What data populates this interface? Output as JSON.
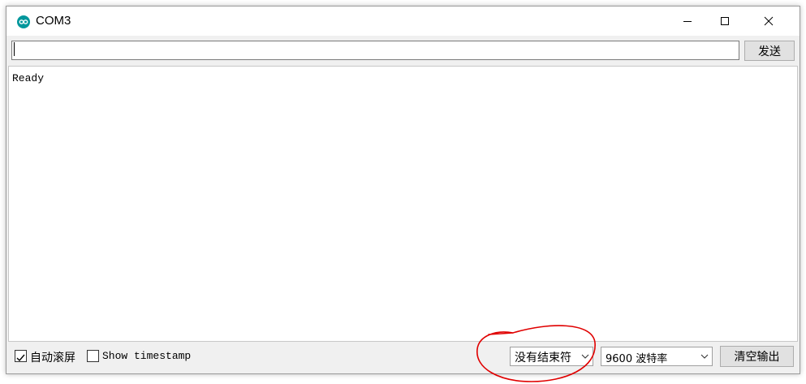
{
  "window": {
    "title": "COM3",
    "icon": "arduino-icon"
  },
  "send": {
    "input_value": "",
    "button_label": "发送"
  },
  "output": {
    "lines": [
      "Ready"
    ]
  },
  "statusbar": {
    "autoscroll": {
      "label": "自动滚屏",
      "checked": true
    },
    "timestamp": {
      "label": "Show timestamp",
      "checked": false
    },
    "line_ending": {
      "selected": "没有结束符"
    },
    "baud_rate": {
      "selected": "9600 波特率"
    },
    "clear_label": "清空输出"
  },
  "colors": {
    "accent": "#00979c",
    "annotation": "#e00000"
  }
}
